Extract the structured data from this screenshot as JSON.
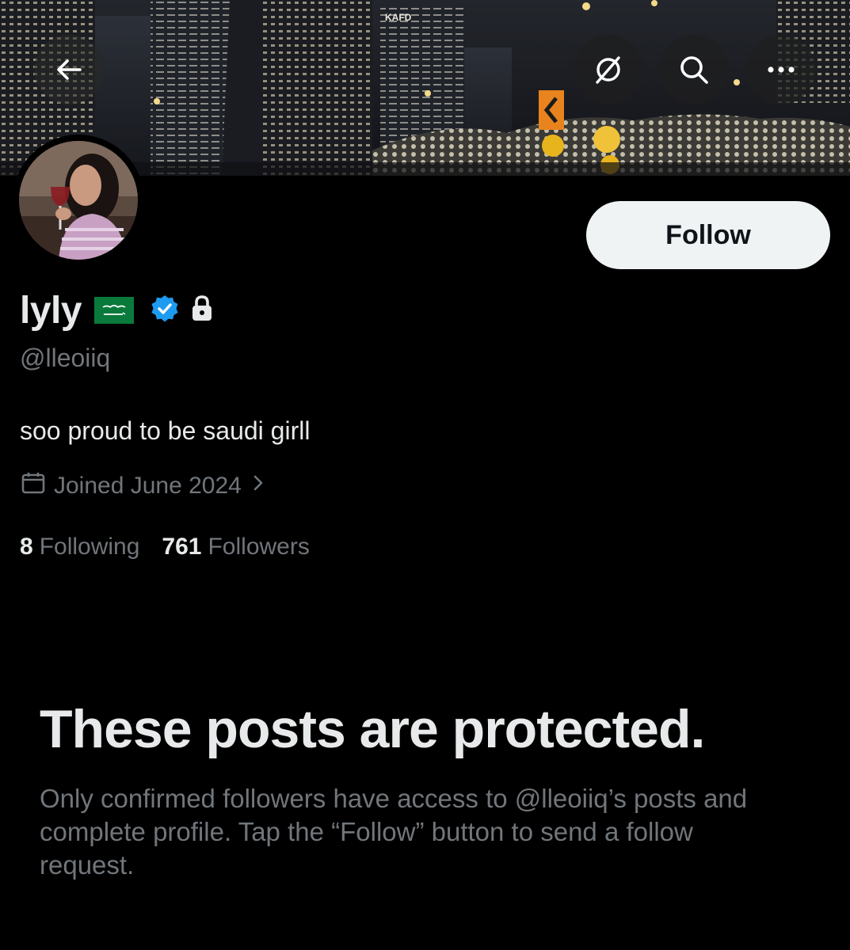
{
  "header": {
    "back_icon": "arrow-left-icon",
    "grok_icon": "grok-icon",
    "search_icon": "search-icon",
    "more_icon": "more-horizontal-icon",
    "banner_sign_text": "KAFD"
  },
  "profile": {
    "display_name": "lyly",
    "flag_icon": "saudi-flag-icon",
    "verified_icon": "verified-badge-icon",
    "lock_icon": "lock-icon",
    "handle": "@lleoiiq",
    "bio": "soo proud to be saudi girll",
    "joined": "Joined June 2024",
    "calendar_icon": "calendar-icon",
    "chevron_icon": "chevron-right-icon",
    "following_count": "8",
    "following_label": "Following",
    "followers_count": "761",
    "followers_label": "Followers"
  },
  "actions": {
    "follow_label": "Follow"
  },
  "protected": {
    "title": "These posts are protected.",
    "message": "Only confirmed followers have access to @lleoiiq’s posts and complete profile. Tap the “Follow” button to send a follow request."
  },
  "colors": {
    "background": "#000000",
    "primary_text": "#e7e9ea",
    "secondary_text": "#71767b",
    "follow_button_bg": "#eff3f4",
    "verified_blue": "#1d9bf0",
    "flag_green": "#0a7a3c"
  }
}
